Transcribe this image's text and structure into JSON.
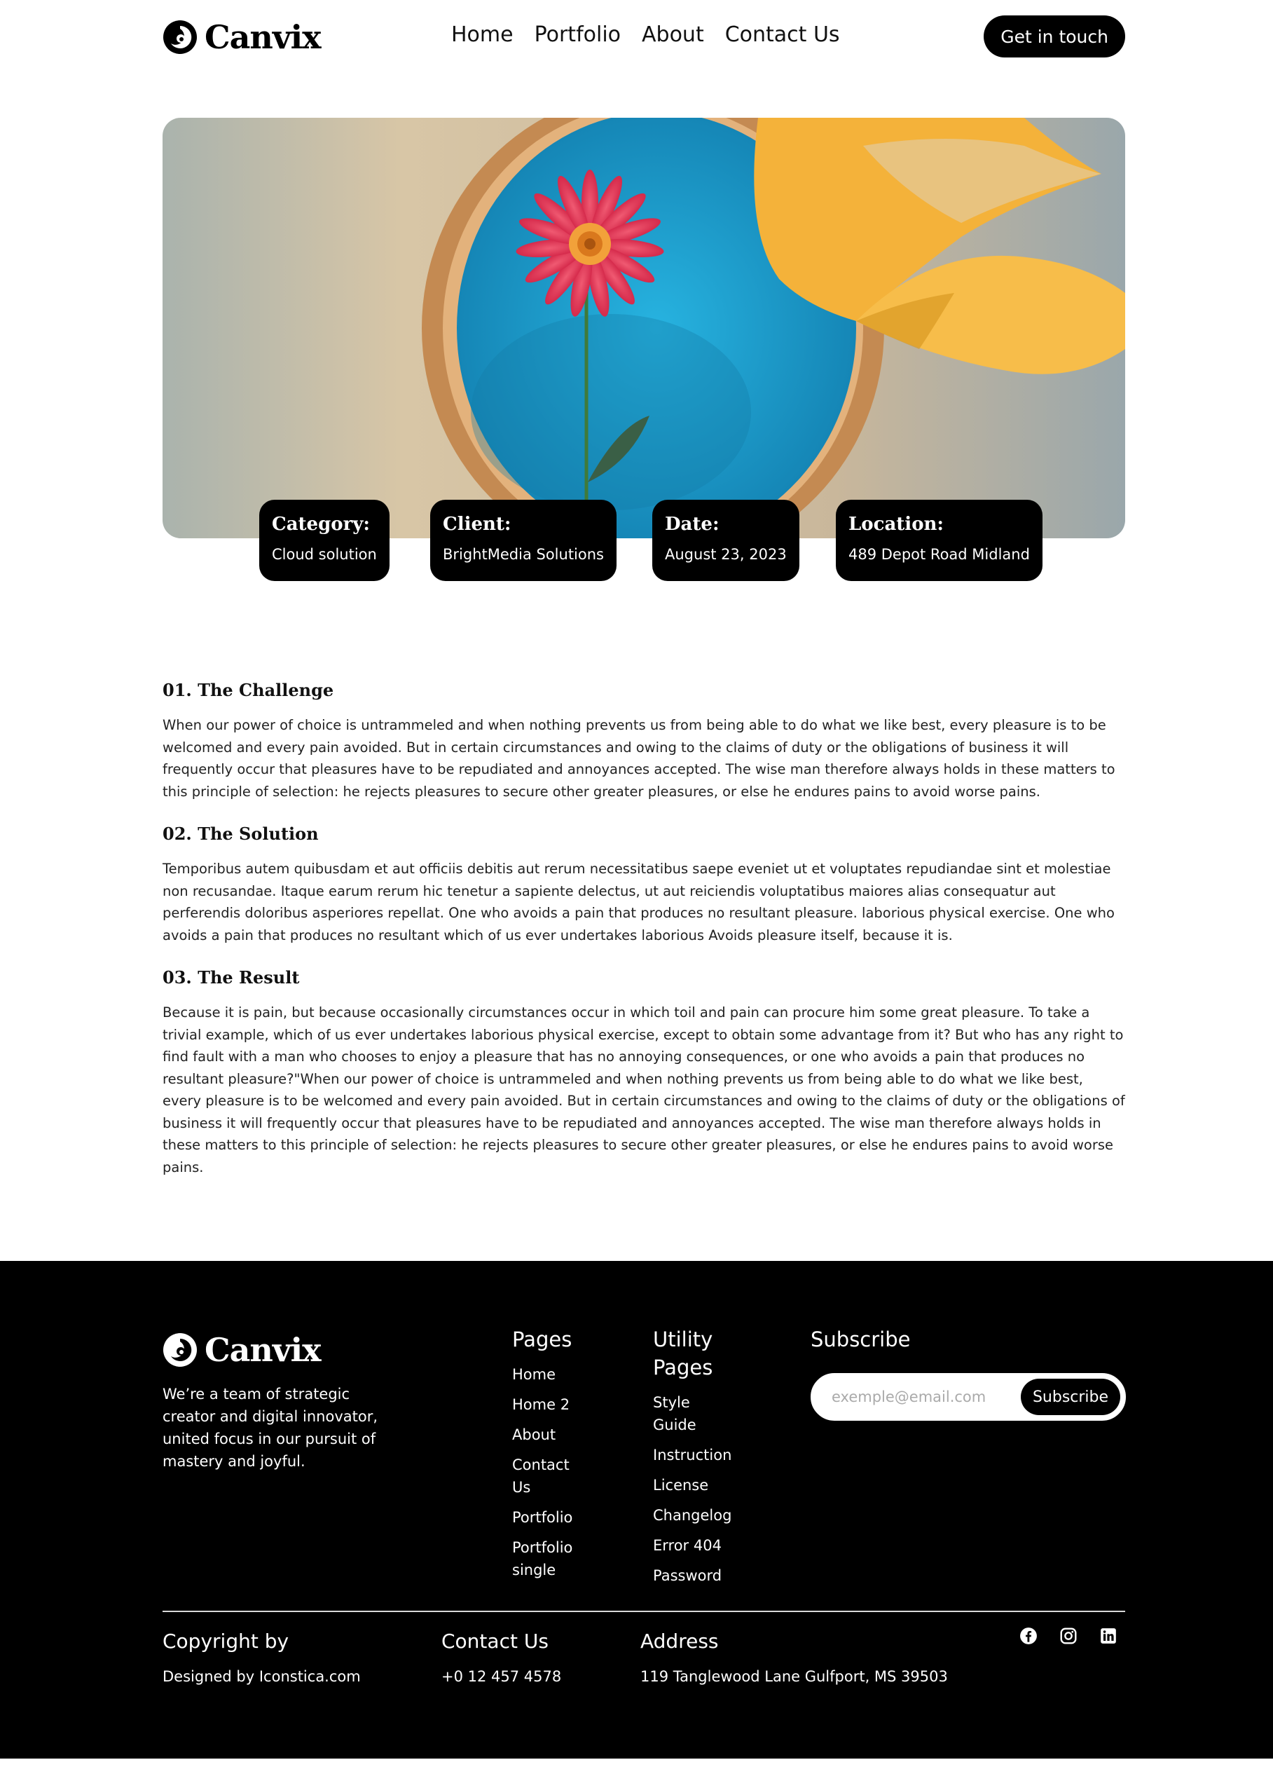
{
  "brand": {
    "name": "Canvix"
  },
  "nav": {
    "items": [
      "Home",
      "Portfolio",
      "About",
      "Contact Us"
    ],
    "cta": "Get in touch"
  },
  "hero": {
    "image": "flower-in-round-frame",
    "colors": {
      "blue": "#1fa3d1",
      "red": "#e23a56",
      "yellow": "#f4b23a"
    }
  },
  "meta": [
    {
      "label": "Category:",
      "value": "Cloud solution"
    },
    {
      "label": "Client:",
      "value": "BrightMedia Solutions"
    },
    {
      "label": "Date:",
      "value": "August 23, 2023"
    },
    {
      "label": "Location:",
      "value": "489 Depot Road Midland"
    }
  ],
  "sections": [
    {
      "title": "01. The Challenge",
      "body": "When our power of choice is untrammeled and when nothing prevents us from being able to do what we like best, every pleasure is to be welcomed and every pain avoided. But in certain circumstances and owing to the claims of duty or the obligations of business it will frequently occur that pleasures have to be repudiated and annoyances accepted. The wise man therefore always holds in these matters to this principle of selection: he rejects pleasures to secure other greater pleasures, or else he endures pains to avoid worse pains."
    },
    {
      "title": "02. The Solution",
      "body": "Temporibus autem quibusdam et aut officiis debitis aut rerum necessitatibus saepe eveniet ut et voluptates repudiandae sint et molestiae non recusandae. Itaque earum rerum hic tenetur a sapiente delectus, ut aut reiciendis voluptatibus maiores alias consequatur aut perferendis doloribus asperiores repellat. One who avoids a pain that produces no resultant pleasure. laborious physical exercise. One who avoids a pain that produces no resultant which of us ever undertakes laborious Avoids pleasure itself, because it is."
    },
    {
      "title": "03. The Result",
      "body": "Because it is pain, but because occasionally circumstances occur in which toil and pain can procure him some great pleasure. To take a trivial example, which of us ever undertakes laborious physical exercise, except to obtain some advantage from it? But who has any right to find fault with a man who chooses to enjoy a pleasure that has no annoying consequences, or one who avoids a pain that produces no resultant pleasure?\"When our power of choice is untrammeled and when nothing prevents us from being able to do what we like best, every pleasure is to be welcomed and every pain avoided. But in certain circumstances and owing to the claims of duty or the obligations of business it will frequently occur that pleasures have to be repudiated and annoyances accepted. The wise man therefore always holds in these matters to this principle of selection: he rejects pleasures to secure other greater pleasures, or else he endures pains to avoid worse pains."
    }
  ],
  "footer": {
    "about": "We’re a team of strategic creator and digital innovator, united focus in our pursuit of mastery and joyful.",
    "pages": {
      "title": "Pages",
      "links": [
        "Home",
        "Home 2",
        "About",
        "Contact Us",
        "Portfolio",
        "Portfolio single"
      ]
    },
    "utility": {
      "title": "Utility Pages",
      "links": [
        "Style Guide",
        "Instruction",
        "License",
        "Changelog",
        "Error 404",
        "Password"
      ]
    },
    "subscribe": {
      "title": "Subscribe",
      "placeholder": "exemple@email.com",
      "button": "Subscribe"
    },
    "copyright": {
      "title": "Copyright by",
      "value": "Designed by Iconstica.com"
    },
    "contact": {
      "title": "Contact Us",
      "value": "+0 12 457 4578"
    },
    "address": {
      "title": "Address",
      "value": "119 Tanglewood Lane Gulfport, MS 39503"
    },
    "socials": [
      "facebook-icon",
      "instagram-icon",
      "linkedin-icon"
    ]
  }
}
